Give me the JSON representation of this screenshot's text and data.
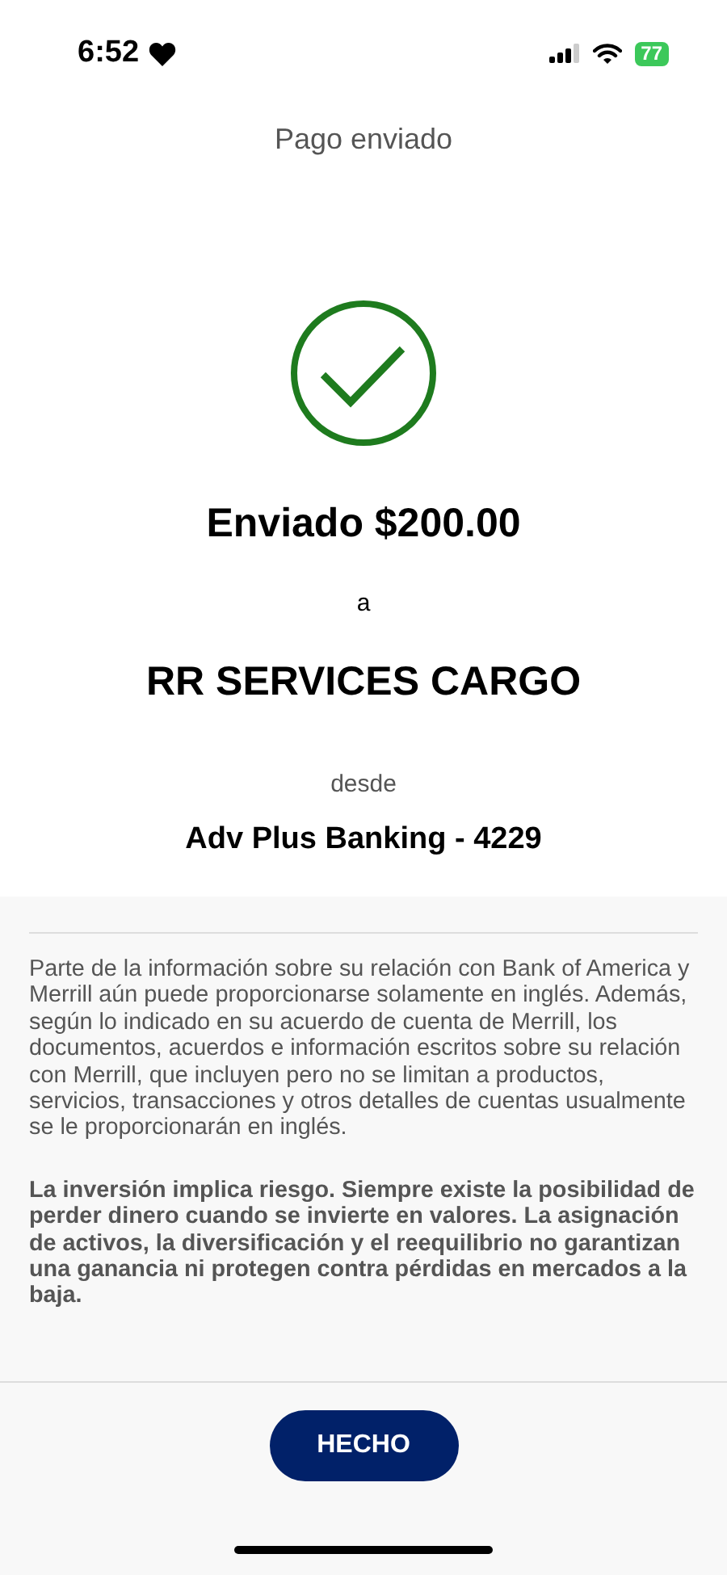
{
  "status_bar": {
    "time": "6:52",
    "battery": "77"
  },
  "header": {
    "title": "Pago enviado"
  },
  "confirmation": {
    "amount_line": "Enviado $200.00",
    "connector": "a",
    "recipient": "RR SERVICES CARGO",
    "from_label": "desde",
    "account": "Adv Plus Banking - 4229"
  },
  "disclosures": [
    {
      "text": "Parte de la información sobre su relación con Bank of America y Merrill aún puede proporcionarse solamente en inglés. Además, según lo indicado en su acuerdo de cuenta de Merrill, los documentos, acuerdos e información escritos sobre su relación con Merrill, que incluyen pero no se limitan a productos, servicios, transacciones y otros detalles de cuentas usualmente se le proporcionarán en inglés.",
      "bold": false
    },
    {
      "text": "La inversión implica riesgo. Siempre existe la posibilidad de perder dinero cuando se invierte en valores. La asignación de activos, la diversificación y el reequilibrio no garantizan una ganancia ni protegen contra pérdidas en mercados a la baja.",
      "bold": true
    }
  ],
  "footer": {
    "button": "HECHO"
  }
}
